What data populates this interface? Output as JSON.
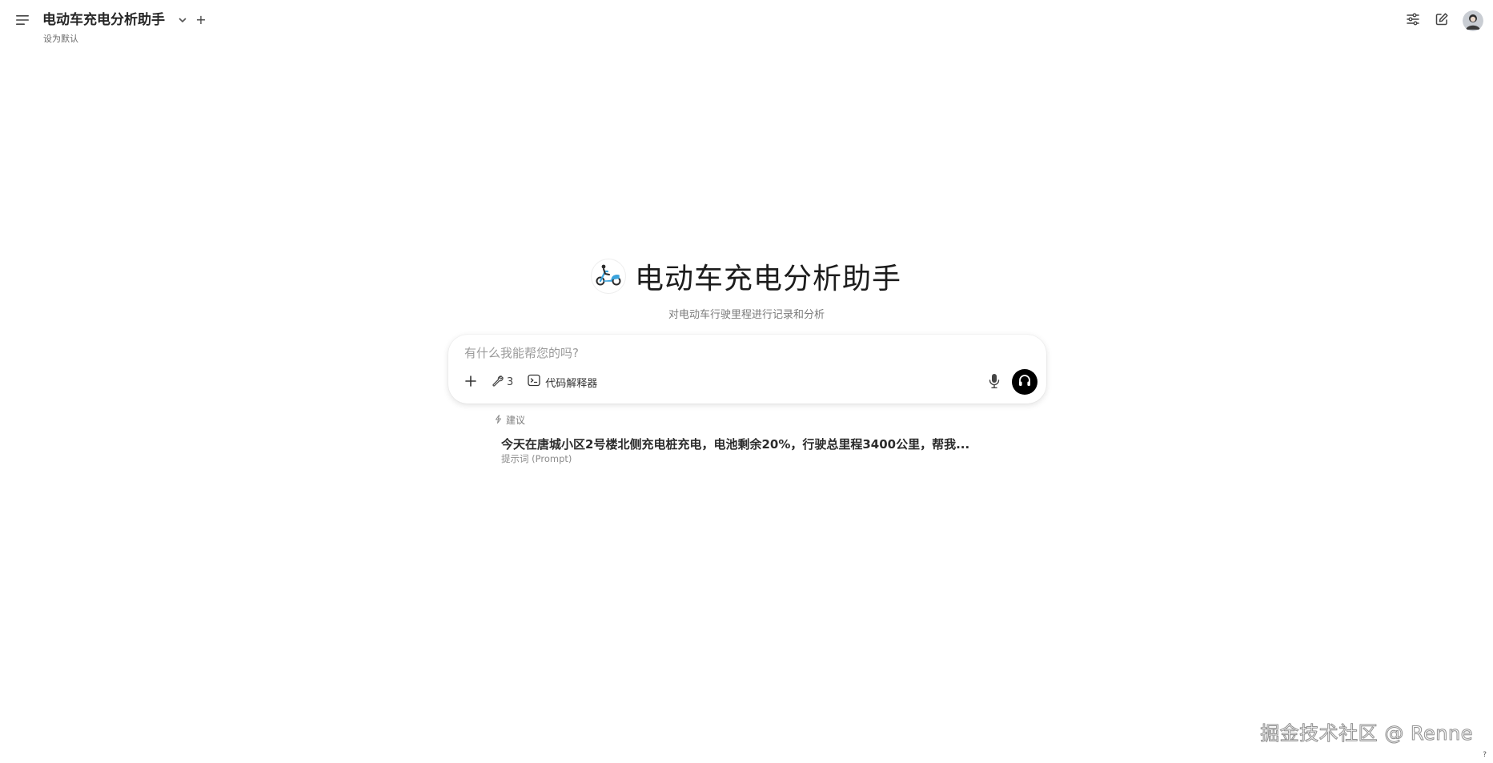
{
  "header": {
    "model_name": "电动车充电分析助手",
    "add_label": "+",
    "set_default_label": "设为默认"
  },
  "hero": {
    "title": "电动车充电分析助手",
    "subtitle": "对电动车行驶里程进行记录和分析"
  },
  "input": {
    "placeholder": "有什么我能帮您的吗?",
    "value": "",
    "tools_count": "3",
    "code_interpreter_label": "代码解释器"
  },
  "suggestions": {
    "header_label": "建议",
    "items": [
      {
        "text": "今天在唐城小区2号楼北侧充电桩充电，电池剩余20%，行驶总里程3400公里，帮我...",
        "type": "提示词 (Prompt)"
      }
    ]
  },
  "watermark": "掘金技术社区 @ Renne",
  "help_label": "?",
  "icons": {
    "menu": "menu-icon",
    "dropdown": "chevron-down-icon",
    "controls": "sliders-icon",
    "new_chat": "edit-icon",
    "logo": "scooter-icon",
    "plus": "plus-icon",
    "tools": "wrench-icon",
    "code": "terminal-icon",
    "mic": "microphone-icon",
    "voice": "headphones-icon",
    "suggest": "sparkle-icon"
  },
  "colors": {
    "background": "#ffffff",
    "voice_button": "#000000",
    "logo_accent": "#3aa3dc"
  }
}
